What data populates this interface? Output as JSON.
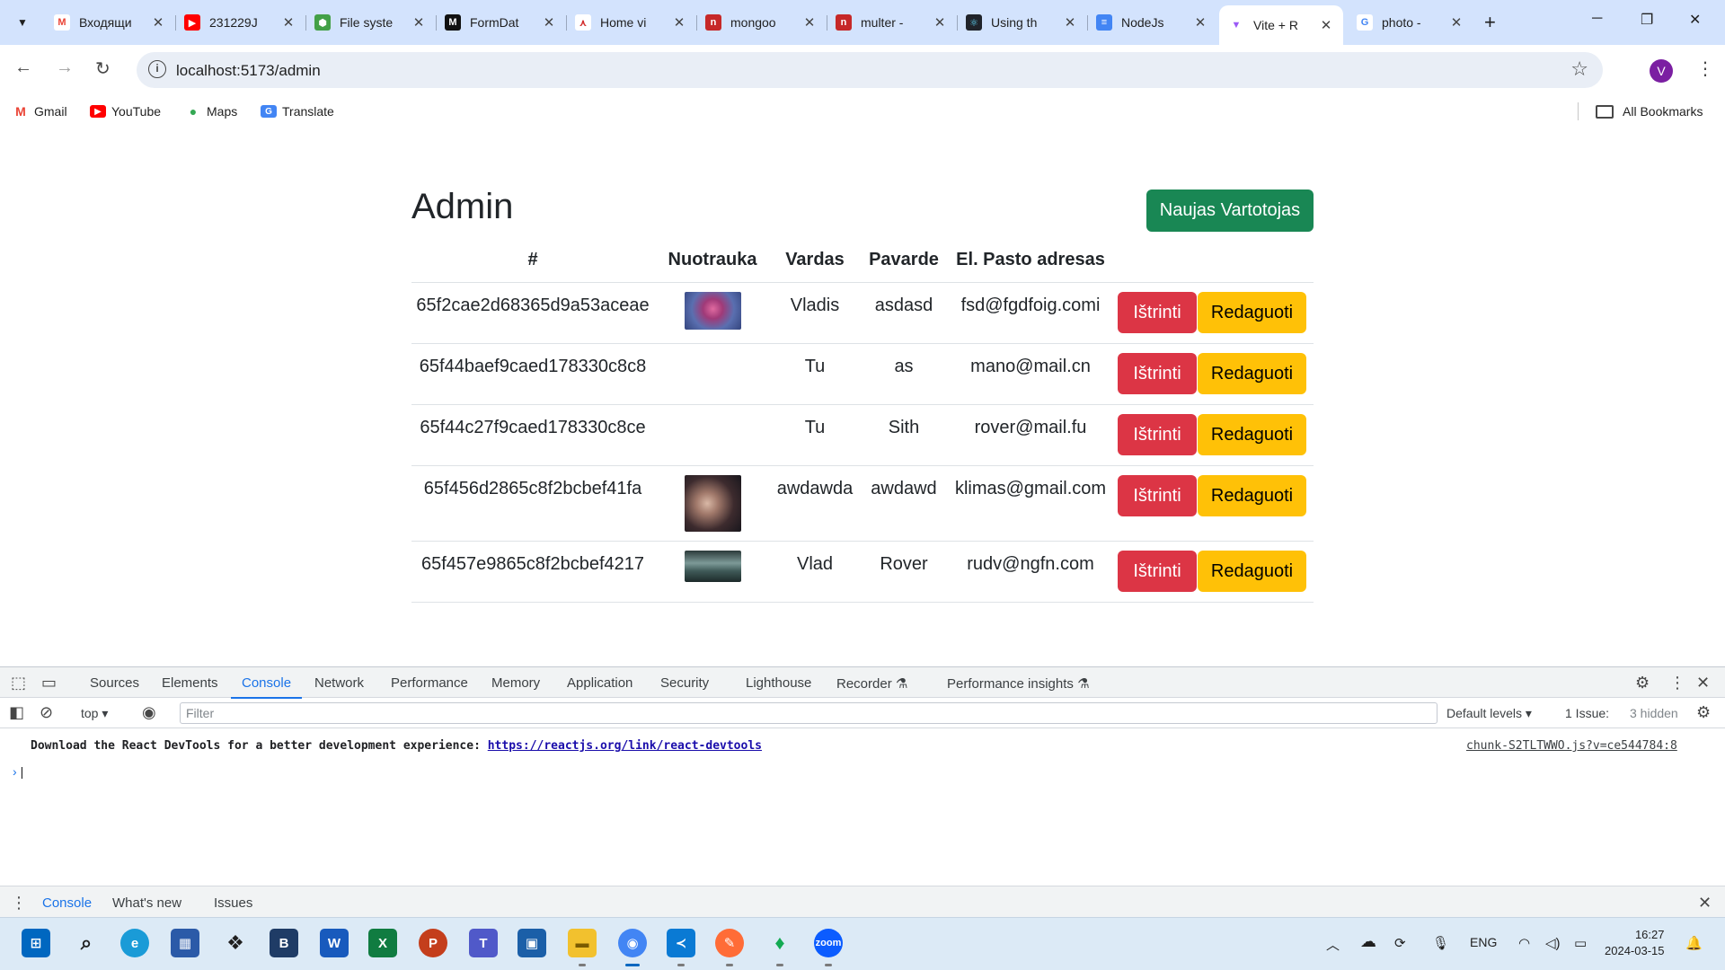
{
  "browser": {
    "tabs": [
      {
        "title": "Входящи",
        "fav_color": "#ffffff",
        "fav_glyph": "M"
      },
      {
        "title": "231229J",
        "fav_color": "#ff0000",
        "fav_glyph": "▶"
      },
      {
        "title": "File syste",
        "fav_color": "#43a047",
        "fav_glyph": "⬢"
      },
      {
        "title": "FormDat",
        "fav_color": "#111111",
        "fav_glyph": "M"
      },
      {
        "title": "Home vi",
        "fav_color": "#ffffff",
        "fav_glyph": "⋏"
      },
      {
        "title": "mongoo",
        "fav_color": "#c62828",
        "fav_glyph": "n"
      },
      {
        "title": "multer -",
        "fav_color": "#c62828",
        "fav_glyph": "n"
      },
      {
        "title": "Using th",
        "fav_color": "#20232a",
        "fav_glyph": "⚛"
      },
      {
        "title": "NodeJs ",
        "fav_color": "#4285f4",
        "fav_glyph": "≡"
      },
      {
        "title": "Vite + R",
        "fav_color": "#ffffff",
        "fav_glyph": "▼"
      },
      {
        "title": "photo - ",
        "fav_color": "#ffffff",
        "fav_glyph": "G"
      }
    ],
    "close_glyph": "✕",
    "new_tab_glyph": "+",
    "minimize_glyph": "─",
    "restore_glyph": "❐",
    "close_window_glyph": "✕",
    "url": "localhost:5173/admin",
    "avatar_letter": "V",
    "bookmarks": [
      {
        "label": "Gmail",
        "color": "#ea4335",
        "glyph": "M"
      },
      {
        "label": "YouTube",
        "color": "#ff0000",
        "glyph": "▶"
      },
      {
        "label": "Maps",
        "color": "#34a853",
        "glyph": "●"
      },
      {
        "label": "Translate",
        "color": "#4285f4",
        "glyph": "G"
      }
    ],
    "all_bookmarks": "All Bookmarks"
  },
  "admin": {
    "title": "Admin",
    "new_user_button": "Naujas Vartotojas",
    "columns": [
      "#",
      "Nuotrauka",
      "Vardas",
      "Pavarde",
      "El. Pasto adresas",
      ""
    ],
    "delete_label": "Ištrinti",
    "edit_label": "Redaguoti",
    "rows": [
      {
        "id": "65f2cae2d68365d9a53aceae",
        "photo": "rose",
        "vardas": "Vladis",
        "pavarde": "asdasd",
        "email": "fsd@fgdfoig.comi"
      },
      {
        "id": "65f44baef9caed178330c8c8",
        "photo": "",
        "vardas": "Tu",
        "pavarde": "as",
        "email": "mano@mail.cn"
      },
      {
        "id": "65f44c27f9caed178330c8ce",
        "photo": "",
        "vardas": "Tu",
        "pavarde": "Sith",
        "email": "rover@mail.fu"
      },
      {
        "id": "65f456d2865c8f2bcbef41fa",
        "photo": "octopus",
        "vardas": "awdawda",
        "pavarde": "awdawd",
        "email": "klimas@gmail.com"
      },
      {
        "id": "65f457e9865c8f2bcbef4217",
        "photo": "landscape",
        "vardas": "Vlad",
        "pavarde": "Rover",
        "email": "rudv@ngfn.com"
      }
    ]
  },
  "devtools": {
    "tabs": [
      "Sources",
      "Elements",
      "Console",
      "Network",
      "Performance",
      "Memory",
      "Application",
      "Security",
      "Lighthouse",
      "Recorder ⚗",
      "Performance insights ⚗"
    ],
    "active_tab": "Console",
    "context": "top",
    "filter_placeholder": "Filter",
    "levels": "Default levels ▾",
    "issues": "1 Issue:",
    "hidden": "3 hidden",
    "message_text": "Download the React DevTools for a better development experience:",
    "message_link": "https://reactjs.org/link/react-devtools",
    "message_source": "chunk-S2TLTWWO.js?v=ce544784:8",
    "drawer_tabs": [
      "Console",
      "What's new",
      "Issues"
    ]
  },
  "taskbar": {
    "apps": [
      {
        "name": "start",
        "color": "#0067c0",
        "glyph": "⊞"
      },
      {
        "name": "search",
        "color": "#dceaf6",
        "glyph": "🔍"
      },
      {
        "name": "edge",
        "color": "#1a9bd7",
        "glyph": "e"
      },
      {
        "name": "store",
        "color": "#2b5aa8",
        "glyph": "▦"
      },
      {
        "name": "dropbox",
        "color": "#dceaf6",
        "glyph": "❖"
      },
      {
        "name": "b-app",
        "color": "#1f3c66",
        "glyph": "B"
      },
      {
        "name": "word",
        "color": "#185abd",
        "glyph": "W"
      },
      {
        "name": "excel",
        "color": "#107c41",
        "glyph": "X"
      },
      {
        "name": "powerpoint",
        "color": "#c43e1c",
        "glyph": "P"
      },
      {
        "name": "teams",
        "color": "#5059c9",
        "glyph": "T"
      },
      {
        "name": "app-window",
        "color": "#1b5fa8",
        "glyph": "▣"
      },
      {
        "name": "files",
        "color": "#f2c12e",
        "glyph": "▬"
      },
      {
        "name": "chrome",
        "color": "#4285f4",
        "glyph": "◉"
      },
      {
        "name": "vscode",
        "color": "#0a7ad4",
        "glyph": "≺"
      },
      {
        "name": "postman",
        "color": "#ff6c37",
        "glyph": "✎"
      },
      {
        "name": "mongodb",
        "color": "#dceaf6",
        "glyph": "♦"
      },
      {
        "name": "zoom",
        "color": "#0b5cff",
        "glyph": "z"
      }
    ],
    "lang": "ENG",
    "time": "16:27",
    "date": "2024-03-15"
  },
  "colors": {
    "success": "#198754",
    "danger": "#dc3545",
    "warning": "#ffc107",
    "chrome_frame": "#d3e3fd",
    "devtools_accent": "#1a73e8"
  }
}
